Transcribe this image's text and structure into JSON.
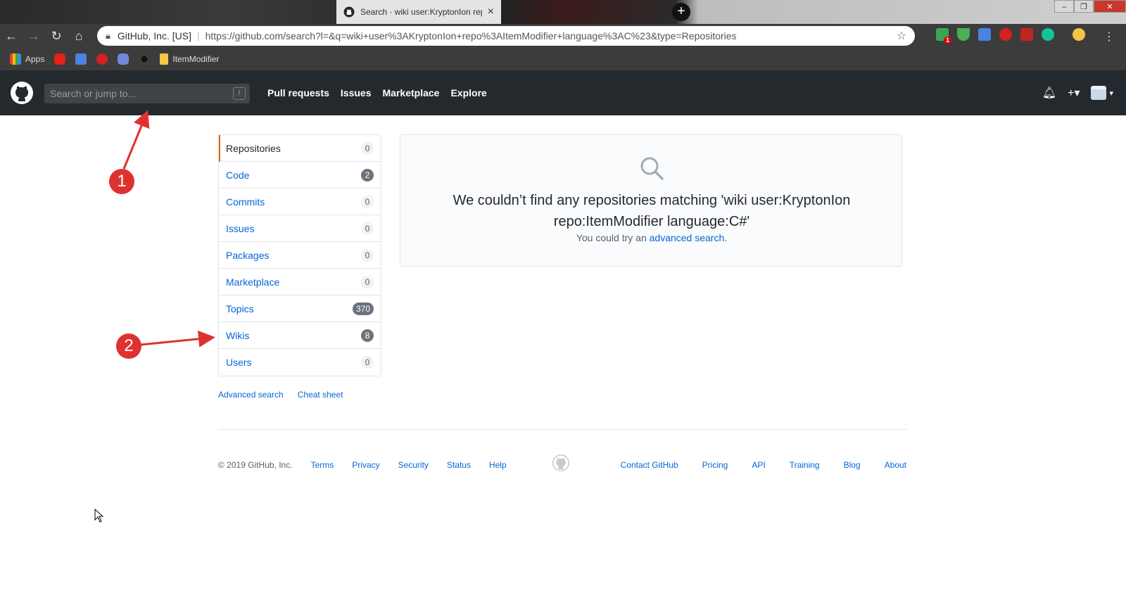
{
  "browser": {
    "tab_title": "Search · wiki user:KryptonIon rep",
    "tab_close": "×",
    "new_tab": "+",
    "window_controls": [
      "‒",
      "❐",
      "✕"
    ],
    "site_identity": "GitHub, Inc. [US]",
    "separator": "|",
    "url": "https://github.com/search?l=&q=wiki+user%3AKryptonIon+repo%3AItemModifier+language%3AC%23&type=Repositories",
    "extension_badge": "1",
    "bookmarks": [
      {
        "label": "Apps",
        "icon": "apps-grid-icon"
      },
      {
        "label": "",
        "icon": "youtube-icon"
      },
      {
        "label": "",
        "icon": "google-translate-icon"
      },
      {
        "label": "",
        "icon": "red-extension-icon"
      },
      {
        "label": "",
        "icon": "discord-icon"
      },
      {
        "label": "",
        "icon": "github-icon"
      },
      {
        "label": "ItemModifier",
        "icon": "folder-icon"
      }
    ]
  },
  "github_header": {
    "search_placeholder": "Search or jump to...",
    "search_shortcut": "/",
    "nav": [
      "Pull requests",
      "Issues",
      "Marketplace",
      "Explore"
    ],
    "plus": "+▾",
    "avatar_caret": "▾"
  },
  "filter_menu": {
    "items": [
      {
        "label": "Repositories",
        "count": "0"
      },
      {
        "label": "Code",
        "count": "2"
      },
      {
        "label": "Commits",
        "count": "0"
      },
      {
        "label": "Issues",
        "count": "0"
      },
      {
        "label": "Packages",
        "count": "0"
      },
      {
        "label": "Marketplace",
        "count": "0"
      },
      {
        "label": "Topics",
        "count": "370"
      },
      {
        "label": "Wikis",
        "count": "8"
      },
      {
        "label": "Users",
        "count": "0"
      }
    ],
    "links": [
      "Advanced search",
      "Cheat sheet"
    ]
  },
  "blankslate": {
    "title": "We couldn’t find any repositories matching 'wiki user:KryptonIon repo:ItemModifier language:C#'",
    "sub_prefix": "You could try an ",
    "sub_link": "advanced search",
    "sub_suffix": "."
  },
  "footer": {
    "copyright": "© 2019 GitHub, Inc.",
    "left_links": [
      "Terms",
      "Privacy",
      "Security",
      "Status",
      "Help"
    ],
    "right_links": [
      "Contact GitHub",
      "Pricing",
      "API",
      "Training",
      "Blog",
      "About"
    ]
  },
  "annotations": [
    "1",
    "2"
  ],
  "colors": {
    "header_bg": "#24292e",
    "link": "#0366d6",
    "selected_accent": "#e36209",
    "annotation_red": "#e03131"
  }
}
